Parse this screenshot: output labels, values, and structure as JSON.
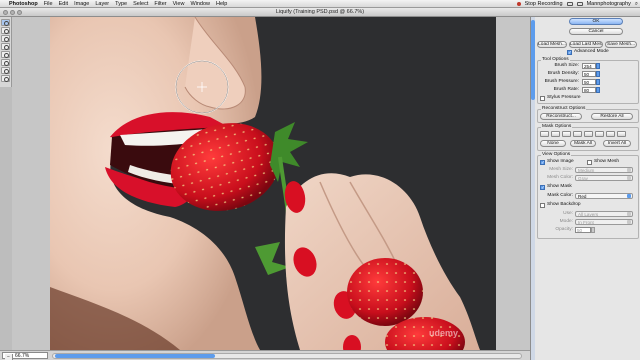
{
  "menubar": {
    "app": "Photoshop",
    "items": [
      "File",
      "Edit",
      "Image",
      "Layer",
      "Type",
      "Select",
      "Filter",
      "View",
      "Window",
      "Help"
    ],
    "recording": "Stop Recording",
    "user": "Mannphotography"
  },
  "window": {
    "title": "Liquify (Training PSD.psd @ 66.7%)"
  },
  "footer": {
    "zoom": "66.7%"
  },
  "watermark": "udemy",
  "panel": {
    "ok_label": "OK",
    "cancel_label": "Cancel",
    "load_mesh": "Load Mesh...",
    "load_last_mesh": "Load Last Mesh",
    "save_mesh": "Save Mesh...",
    "advanced_mode": "Advanced Mode",
    "tool_options": {
      "title": "Tool Options",
      "brush_size_label": "Brush Size:",
      "brush_size": "254",
      "brush_density_label": "Brush Density:",
      "brush_density": "50",
      "brush_pressure_label": "Brush Pressure:",
      "brush_pressure": "50",
      "brush_rate_label": "Brush Rate:",
      "brush_rate": "80",
      "stylus_pressure": "Stylus Pressure"
    },
    "reconstruct": {
      "title": "Reconstruct Options",
      "reconstruct_label": "Reconstruct...",
      "restore_all_label": "Restore All"
    },
    "mask": {
      "title": "Mask Options",
      "none_label": "None",
      "mask_all_label": "Mask All",
      "invert_all_label": "Invert All"
    },
    "view": {
      "title": "View Options",
      "show_image": "Show Image",
      "show_mesh": "Show Mesh",
      "mesh_size_label": "Mesh Size:",
      "mesh_size": "Medium",
      "mesh_color_label": "Mesh Color:",
      "mesh_color": "Gray",
      "show_mask": "Show Mask",
      "mask_color_label": "Mask Color:",
      "mask_color": "Red",
      "show_backdrop": "Show Backdrop",
      "use_label": "Use:",
      "use_value": "All Layers",
      "mode_label": "Mode:",
      "mode_value": "In Front",
      "opacity_label": "Opacity:",
      "opacity_value": "50"
    }
  },
  "colors": {
    "accent": "#5d9cec",
    "lips": "#d8102a",
    "strawberry": "#c80e1c"
  }
}
